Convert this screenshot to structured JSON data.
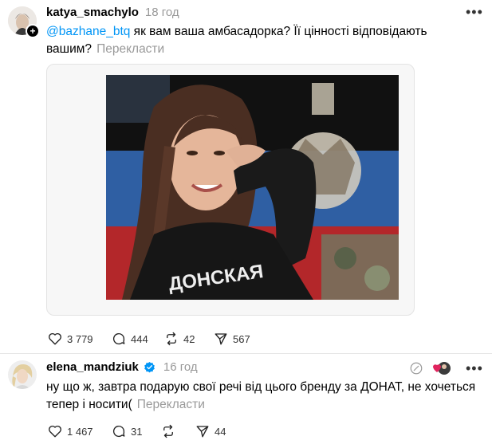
{
  "post1": {
    "username": "katya_smachylo",
    "time": "18 год",
    "mention": "@bazhane_btq",
    "text_line1": " як вам ваша амбасадорка? Її цінності відповідають",
    "text_line2": "вашим?",
    "translate": "Перекласти",
    "image_alt": "Selfie photo of a woman in front of a flag",
    "image_shirt_text": "ДОНСКАЯ",
    "actions": {
      "likes": "3 779",
      "comments": "444",
      "reposts": "42",
      "shares": "567"
    }
  },
  "post2": {
    "username": "elena_mandziuk",
    "time": "16 год",
    "text_line1": "ну що ж, завтра подарую свої речі від цього бренду за ДОНАТ, не хочеться",
    "text_line2": "тепер і носити(",
    "translate": "Перекласти",
    "actions": {
      "likes": "1 467",
      "comments": "31",
      "reposts": "",
      "shares": "44"
    }
  },
  "colors": {
    "link": "#0095f6",
    "muted": "#999999",
    "verified": "#0095f6"
  },
  "icons": [
    "heart-icon",
    "comment-icon",
    "repost-icon",
    "share-icon",
    "more-icon",
    "verified-icon",
    "plus-icon"
  ]
}
